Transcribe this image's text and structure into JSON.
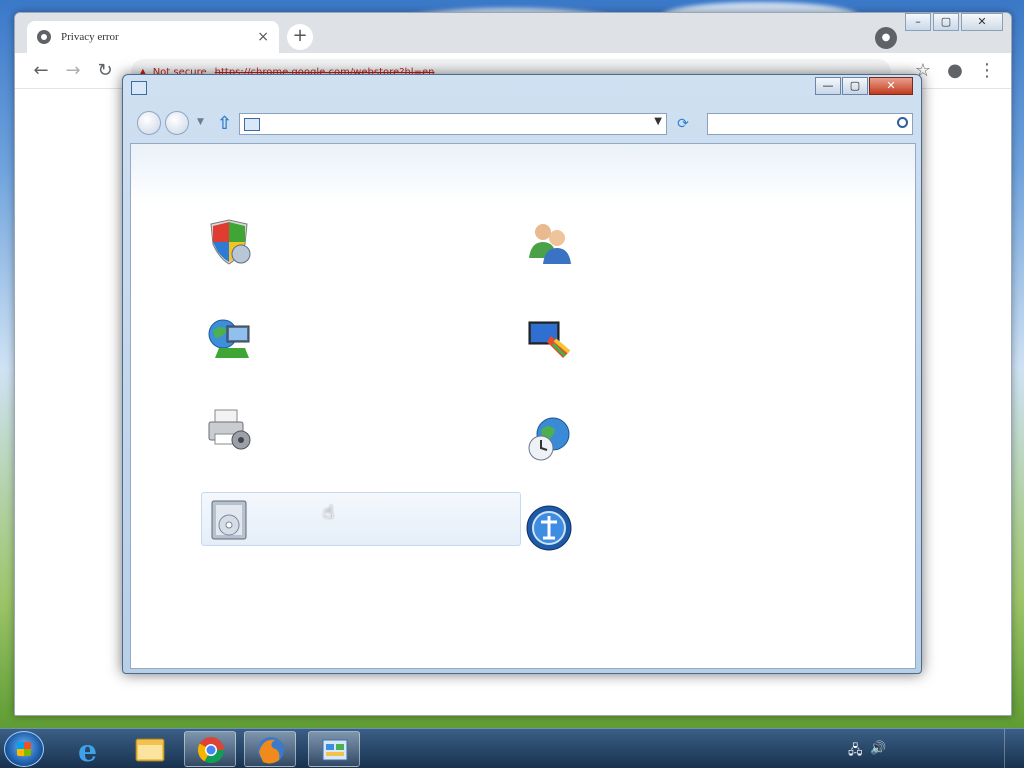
{
  "browser": {
    "tab_title": "Privacy error",
    "tab_close": "×",
    "new_tab": "+",
    "not_secure": "Not secure",
    "url": "https://chrome.google.com/webstore?hl=en",
    "back": "←",
    "forward": "→",
    "reload": "↻",
    "star": "☆",
    "menu": "⋮"
  },
  "control_panel": {
    "window_title": "",
    "breadcrumb": "",
    "search_placeholder": "",
    "heading": "",
    "view_by": "",
    "minimize": "—",
    "maximize": "▢",
    "close": "✕"
  },
  "categories": [
    {
      "icon": "shield-icon",
      "title": "",
      "links": [
        "",
        "",
        ""
      ]
    },
    {
      "icon": "globe-network-icon",
      "title": "",
      "links": [
        "",
        "",
        ""
      ]
    },
    {
      "icon": "printer-icon",
      "title": "",
      "links": [
        "",
        ""
      ]
    },
    {
      "icon": "programs-icon",
      "title": "",
      "links": [
        ""
      ]
    },
    {
      "icon": "users-icon",
      "title": "",
      "links": [
        "",
        "",
        ""
      ]
    },
    {
      "icon": "display-icon",
      "title": "",
      "links": [
        "",
        "",
        ""
      ]
    },
    {
      "icon": "clock-globe-icon",
      "title": "",
      "links": [
        "",
        "",
        ""
      ]
    },
    {
      "icon": "ease-of-access-icon",
      "title": "",
      "links": [
        "",
        ""
      ]
    }
  ],
  "taskbar": {
    "time": "",
    "date": ""
  }
}
